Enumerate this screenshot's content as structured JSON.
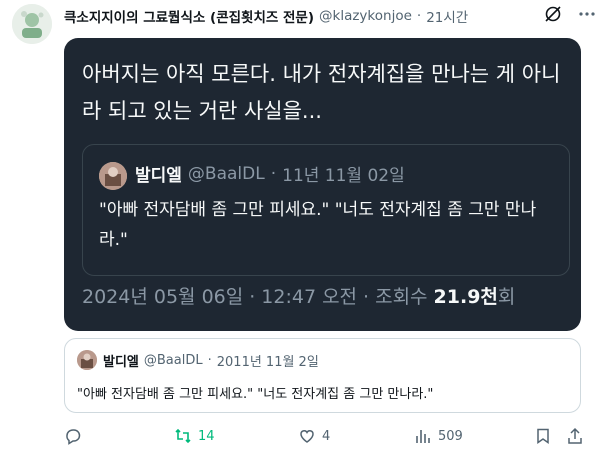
{
  "tweet": {
    "author_name": "큭소지지이의 그료뭡식소 (콘집횟치즈 전문)",
    "author_handle": "@klazykonjoe",
    "separator": "·",
    "time": "21시간"
  },
  "dark_card": {
    "text": "아버지는 아직 모른다. 내가 전자계집을 만나는 게 아니라 되고 있는 거란 사실을...",
    "quote": {
      "author_name": "발디엘",
      "author_handle": "@BaalDL",
      "separator": "·",
      "date": "11년 11월 02일",
      "text": "\"아빠 전자담배 좀 그만 피세요.\" \"너도 전자계집 좀 그만 만나라.\""
    },
    "meta": {
      "date": "2024년 05월 06일",
      "separator1": "·",
      "time": "12:47 오전",
      "separator2": "·",
      "views_label": "조회수",
      "views_value": "21.9천",
      "views_suffix": "회"
    }
  },
  "quoted_tweet": {
    "author_name": "발디엘",
    "author_handle": "@BaalDL",
    "separator": "·",
    "date": "2011년 11월 2일",
    "text": "\"아빠 전자담배 좀 그만 피세요.\" \"너도 전자계집 좀 그만 만나라.\""
  },
  "actions": {
    "replies": "",
    "retweets": "14",
    "likes": "4",
    "views": "509"
  },
  "colors": {
    "retweet_green": "#00ba7c",
    "muted": "#536471",
    "dark_bg": "#1e2732"
  },
  "icons": [
    "grok-icon",
    "more-icon",
    "reply-icon",
    "retweet-icon",
    "like-icon",
    "views-icon",
    "bookmark-icon",
    "share-icon"
  ]
}
